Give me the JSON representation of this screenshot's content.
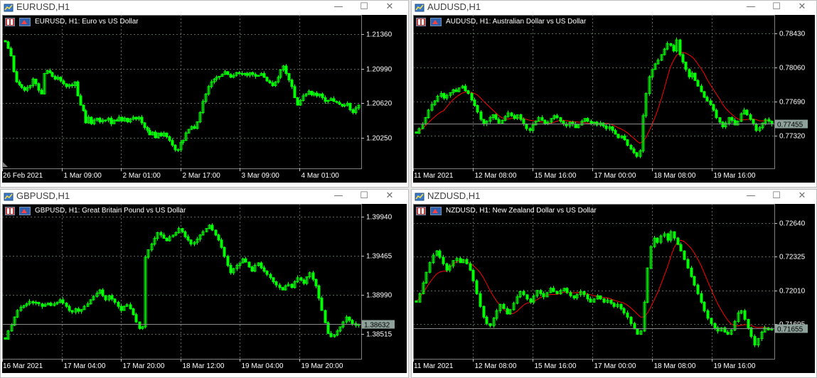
{
  "colors": {
    "bull": "#00ff00",
    "ma": "#ff0000",
    "grid": "#5a6a5a",
    "text": "#ffffff",
    "bg": "#000000",
    "price_tag": "#8ea19a"
  },
  "icons": {
    "window": "chart-window-icon",
    "minimize": "minimize-icon",
    "maximize": "maximize-icon",
    "close": "close-icon"
  },
  "window_controls": {
    "minimize": "—",
    "maximize": "☐",
    "close": "✕"
  },
  "windows": [
    {
      "title": "EURUSD,H1",
      "header": "EURUSD, H1:  Euro vs US Dollar",
      "price_labels": [
        "1.21360",
        "1.20990",
        "1.20620",
        "1.20250"
      ],
      "time_labels": [
        "26 Feb 2021",
        "1 Mar 09:00",
        "2 Mar 01:00",
        "2 Mar 17:00",
        "3 Mar 09:00",
        "4 Mar 01:00"
      ],
      "current_price": "",
      "chart_data": {
        "type": "candlestick",
        "yticks": [
          1.2136,
          1.2099,
          1.2062,
          1.2025
        ],
        "ylim": [
          1.1992,
          1.2157
        ],
        "ma": false,
        "closes": [
          1.2128,
          1.2121,
          1.2113,
          1.2096,
          1.2085,
          1.2082,
          1.2079,
          1.2076,
          1.2079,
          1.2081,
          1.2088,
          1.2083,
          1.2076,
          1.2072,
          1.2094,
          1.2097,
          1.2095,
          1.2091,
          1.2088,
          1.209,
          1.2086,
          1.2083,
          1.208,
          1.2082,
          1.2081,
          1.2085,
          1.207,
          1.206,
          1.2054,
          1.2041,
          1.2047,
          1.204,
          1.2044,
          1.2046,
          1.2042,
          1.2044,
          1.2044,
          1.2046,
          1.204,
          1.2044,
          1.2043,
          1.2047,
          1.2043,
          1.2046,
          1.2042,
          1.2045,
          1.2047,
          1.2045,
          1.2047,
          1.2041,
          1.2036,
          1.2033,
          1.2028,
          1.2031,
          1.2025,
          1.203,
          1.2027,
          1.203,
          1.2026,
          1.2022,
          1.2017,
          1.2012,
          1.2012,
          1.202,
          1.2022,
          1.203,
          1.2034,
          1.2037,
          1.2035,
          1.2042,
          1.2052,
          1.2064,
          1.2072,
          1.208,
          1.2085,
          1.2088,
          1.209,
          1.2091,
          1.2093,
          1.2096,
          1.2093,
          1.209,
          1.2092,
          1.2095,
          1.2094,
          1.2093,
          1.2094,
          1.2092,
          1.2095,
          1.2093,
          1.2091,
          1.2092,
          1.2094,
          1.209,
          1.2086,
          1.2084,
          1.2081,
          1.2085,
          1.209,
          1.2098,
          1.2102,
          1.2094,
          1.2087,
          1.208,
          1.2068,
          1.206,
          1.2065,
          1.207,
          1.2072,
          1.2075,
          1.2071,
          1.2073,
          1.207,
          1.2072,
          1.2068,
          1.2064,
          1.2065,
          1.2067,
          1.2064,
          1.2063,
          1.2061,
          1.2059,
          1.206,
          1.2062,
          1.2055,
          1.2052,
          1.2057,
          1.206
        ]
      }
    },
    {
      "title": "AUDUSD,H1",
      "header": "AUDUSD, H1:  Australian Dollar vs US Dollar",
      "price_labels": [
        "0.78430",
        "0.78060",
        "0.77690",
        "0.77320"
      ],
      "time_labels": [
        "11 Mar 2021",
        "12 Mar 08:00",
        "15 Mar 16:00",
        "17 Mar 00:00",
        "18 Mar 08:00",
        "19 Mar 16:00"
      ],
      "current_price": "0.77455",
      "chart_data": {
        "type": "candlestick",
        "yticks": [
          0.7843,
          0.7806,
          0.7769,
          0.7732
        ],
        "ylim": [
          0.7697,
          0.7863
        ],
        "ma": true,
        "price_line": 0.77455,
        "closes": [
          0.7735,
          0.774,
          0.7745,
          0.7752,
          0.776,
          0.7766,
          0.777,
          0.7775,
          0.7778,
          0.7773,
          0.7776,
          0.7779,
          0.7782,
          0.778,
          0.7784,
          0.7786,
          0.7781,
          0.7778,
          0.7771,
          0.7765,
          0.7758,
          0.775,
          0.7745,
          0.7748,
          0.7752,
          0.7755,
          0.775,
          0.7746,
          0.7749,
          0.7753,
          0.7757,
          0.7754,
          0.7751,
          0.7755,
          0.775,
          0.7745,
          0.774,
          0.7738,
          0.7744,
          0.7748,
          0.7752,
          0.7749,
          0.7745,
          0.7747,
          0.7751,
          0.7754,
          0.7752,
          0.7748,
          0.7745,
          0.7743,
          0.7747,
          0.7745,
          0.7741,
          0.7744,
          0.7748,
          0.7751,
          0.7748,
          0.7745,
          0.7747,
          0.7744,
          0.7746,
          0.7743,
          0.774,
          0.7742,
          0.7738,
          0.7734,
          0.773,
          0.7732,
          0.7728,
          0.7722,
          0.7718,
          0.7714,
          0.771,
          0.7716,
          0.7754,
          0.7778,
          0.7796,
          0.7804,
          0.781,
          0.7814,
          0.782,
          0.7826,
          0.7832,
          0.783,
          0.7824,
          0.7836,
          0.782,
          0.7812,
          0.7804,
          0.7796,
          0.78,
          0.7792,
          0.7786,
          0.778,
          0.7774,
          0.777,
          0.7766,
          0.776,
          0.7752,
          0.7747,
          0.7742,
          0.7746,
          0.7752,
          0.7749,
          0.7744,
          0.7748,
          0.7756,
          0.776,
          0.7755,
          0.775,
          0.7745,
          0.7738,
          0.7741,
          0.7746,
          0.775,
          0.7748,
          0.7745
        ]
      }
    },
    {
      "title": "GBPUSD,H1",
      "header": "GBPUSD, H1:  Great Britain Pound vs US Dollar",
      "price_labels": [
        "1.39940",
        "1.39465",
        "1.38990",
        "1.38515"
      ],
      "time_labels": [
        "16 Mar 2021",
        "17 Mar 04:00",
        "17 Mar 20:00",
        "18 Mar 12:00",
        "19 Mar 04:00",
        "19 Mar 20:00"
      ],
      "current_price": "1.38632",
      "chart_data": {
        "type": "candlestick",
        "yticks": [
          1.3994,
          1.39465,
          1.3899,
          1.38515
        ],
        "ylim": [
          1.3821,
          1.401
        ],
        "ma": false,
        "price_line": 1.38632,
        "closes": [
          1.3845,
          1.3855,
          1.3862,
          1.3872,
          1.388,
          1.3884,
          1.3886,
          1.3888,
          1.3891,
          1.3889,
          1.389,
          1.3888,
          1.3885,
          1.3887,
          1.3889,
          1.3886,
          1.3888,
          1.389,
          1.3893,
          1.3889,
          1.3885,
          1.388,
          1.3878,
          1.3882,
          1.3879,
          1.3881,
          1.3885,
          1.3888,
          1.3893,
          1.3897,
          1.3901,
          1.3905,
          1.3898,
          1.3893,
          1.3898,
          1.3894,
          1.389,
          1.3885,
          1.388,
          1.3885,
          1.3887,
          1.3882,
          1.3875,
          1.3866,
          1.3858,
          1.386,
          1.3945,
          1.3954,
          1.3961,
          1.3968,
          1.3975,
          1.3972,
          1.3968,
          1.3965,
          1.397,
          1.3972,
          1.3975,
          1.398,
          1.3976,
          1.397,
          1.3966,
          1.3961,
          1.3963,
          1.3967,
          1.3972,
          1.3976,
          1.398,
          1.3984,
          1.3978,
          1.3972,
          1.3966,
          1.3957,
          1.3946,
          1.3935,
          1.3926,
          1.3931,
          1.3935,
          1.3938,
          1.3943,
          1.3939,
          1.3933,
          1.3928,
          1.3935,
          1.3938,
          1.3932,
          1.3928,
          1.3924,
          1.392,
          1.3915,
          1.3911,
          1.3908,
          1.3905,
          1.391,
          1.3912,
          1.3908,
          1.3915,
          1.392,
          1.3917,
          1.3913,
          1.3921,
          1.3926,
          1.3918,
          1.391,
          1.3895,
          1.388,
          1.3865,
          1.3852,
          1.3848,
          1.385,
          1.3855,
          1.386,
          1.3866,
          1.3872,
          1.3868,
          1.3864,
          1.3862,
          1.3863
        ]
      }
    },
    {
      "title": "NZDUSD,H1",
      "header": "NZDUSD, H1:  New Zealand Dollar vs US Dollar",
      "price_labels": [
        "0.72640",
        "0.72325",
        "0.72010",
        "0.71695"
      ],
      "time_labels": [
        "11 Mar 2021",
        "12 Mar 08:00",
        "15 Mar 16:00",
        "17 Mar 00:00",
        "18 Mar 08:00",
        "19 Mar 16:00"
      ],
      "current_price": "0.71655",
      "chart_data": {
        "type": "candlestick",
        "yticks": [
          0.7264,
          0.72325,
          0.7201,
          0.71695
        ],
        "ylim": [
          0.7137,
          0.7282
        ],
        "ma": true,
        "price_line": 0.71655,
        "closes": [
          0.719,
          0.7198,
          0.7208,
          0.7218,
          0.7227,
          0.7234,
          0.7238,
          0.7232,
          0.7226,
          0.722,
          0.7224,
          0.7229,
          0.7231,
          0.7227,
          0.723,
          0.7226,
          0.722,
          0.721,
          0.7198,
          0.7186,
          0.7176,
          0.717,
          0.7168,
          0.7175,
          0.7182,
          0.7188,
          0.7184,
          0.7179,
          0.7183,
          0.7189,
          0.7195,
          0.72,
          0.7197,
          0.7193,
          0.719,
          0.7196,
          0.7201,
          0.7198,
          0.7195,
          0.7199,
          0.7203,
          0.72,
          0.7198,
          0.7201,
          0.7203,
          0.7199,
          0.7196,
          0.7194,
          0.7197,
          0.72,
          0.7197,
          0.7193,
          0.719,
          0.7193,
          0.7196,
          0.7193,
          0.719,
          0.7192,
          0.7189,
          0.7186,
          0.7188,
          0.7184,
          0.718,
          0.7176,
          0.717,
          0.7165,
          0.716,
          0.7163,
          0.719,
          0.7222,
          0.7242,
          0.725,
          0.7246,
          0.7252,
          0.7254,
          0.7248,
          0.7256,
          0.725,
          0.7244,
          0.7238,
          0.723,
          0.7222,
          0.7214,
          0.7206,
          0.7198,
          0.719,
          0.7182,
          0.7175,
          0.717,
          0.7166,
          0.7163,
          0.7166,
          0.7162,
          0.716,
          0.7164,
          0.7172,
          0.718,
          0.7182,
          0.7174,
          0.7166,
          0.7158,
          0.715,
          0.7156,
          0.7162,
          0.7166,
          0.7164,
          0.7165
        ]
      }
    }
  ]
}
